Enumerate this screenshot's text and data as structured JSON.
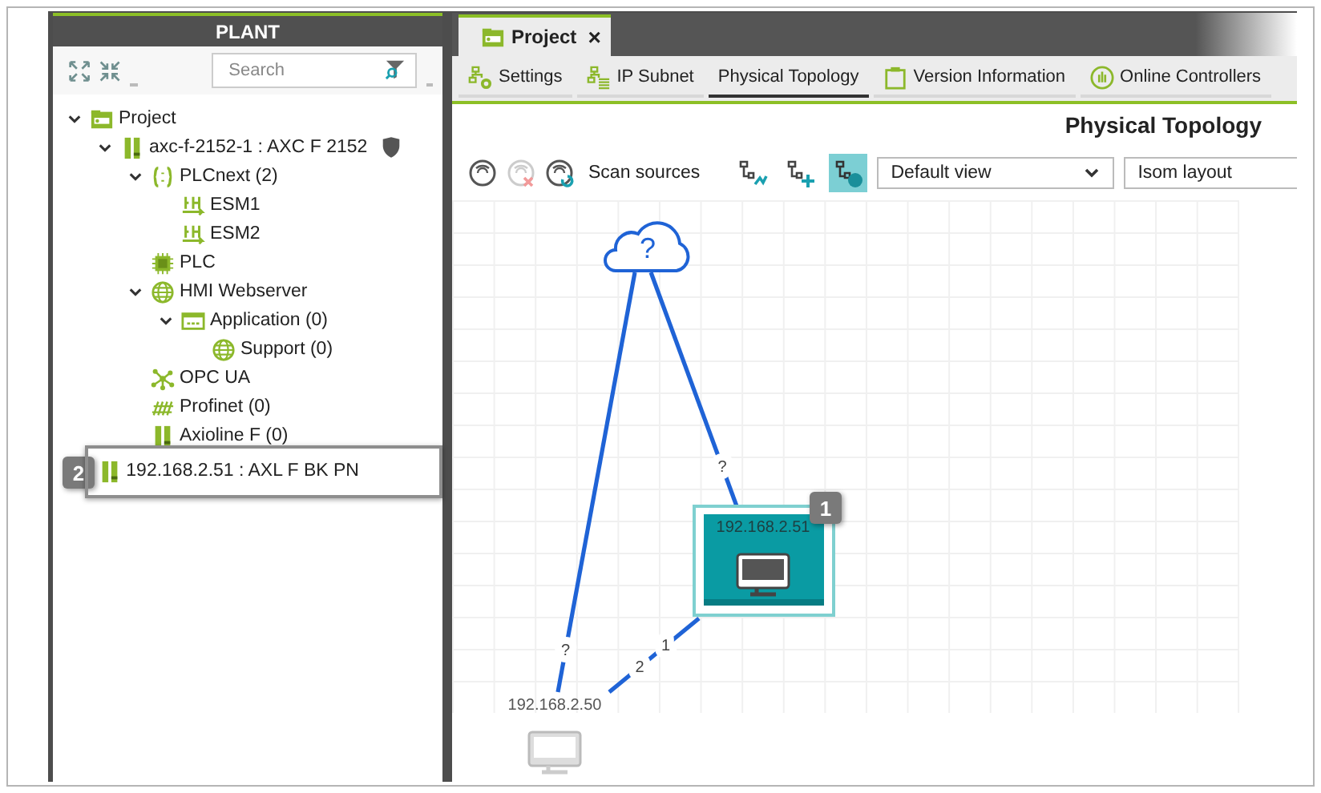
{
  "plant": {
    "title": "PLANT",
    "search": {
      "placeholder": "Search"
    },
    "tree": [
      {
        "label": "Project",
        "kind": "project",
        "expanded": true,
        "children": [
          {
            "label": "axc-f-2152-1 : AXC F 2152",
            "kind": "controller",
            "secured": true,
            "expanded": true,
            "children": [
              {
                "label": "PLCnext (2)",
                "kind": "plcnext",
                "expanded": true,
                "children": [
                  {
                    "label": "ESM1",
                    "kind": "esm"
                  },
                  {
                    "label": "ESM2",
                    "kind": "esm"
                  }
                ]
              },
              {
                "label": "PLC",
                "kind": "plc"
              },
              {
                "label": "HMI Webserver",
                "kind": "web",
                "expanded": true,
                "children": [
                  {
                    "label": "Application (0)",
                    "kind": "app",
                    "expanded": true,
                    "children": [
                      {
                        "label": "Support (0)",
                        "kind": "web"
                      }
                    ]
                  }
                ]
              },
              {
                "label": "OPC UA",
                "kind": "opcua"
              },
              {
                "label": "Profinet (0)",
                "kind": "profinet"
              },
              {
                "label": "Axioline F (0)",
                "kind": "axioline"
              }
            ]
          },
          {
            "label": "192.168.2.51 : AXL F BK PN",
            "kind": "controller",
            "highlighted": true,
            "callout": "2"
          }
        ]
      }
    ]
  },
  "editor": {
    "tabs": [
      {
        "label": "Project",
        "close": "×",
        "selected": true
      }
    ],
    "views": [
      {
        "label": "Settings",
        "kind": "settings",
        "selected": false
      },
      {
        "label": "IP Subnet",
        "kind": "subnet",
        "selected": false
      },
      {
        "label": "Physical Topology",
        "kind": "plain",
        "selected": true
      },
      {
        "label": "Version Information",
        "kind": "version",
        "selected": false
      },
      {
        "label": "Online Controllers",
        "kind": "online",
        "selected": false
      }
    ],
    "heading": "Physical Topology",
    "scan_tools": [
      {
        "kind": "scan",
        "disabled": false
      },
      {
        "kind": "stop",
        "disabled": true
      },
      {
        "kind": "rescan",
        "disabled": false
      }
    ],
    "scan_label": "Scan sources",
    "layout_tools": [
      {
        "kind": "arrange",
        "selected": false
      },
      {
        "kind": "add",
        "selected": false
      },
      {
        "kind": "auto",
        "selected": true
      }
    ],
    "view_select": {
      "value": "Default view"
    },
    "layout_select": {
      "value": "Isom layout"
    },
    "topology": {
      "nodes": [
        {
          "kind": "cloud",
          "label": "?"
        },
        {
          "kind": "device",
          "label": "192.168.2.51",
          "selected": true,
          "callout": "1"
        },
        {
          "kind": "device",
          "label": "192.168.2.50",
          "selected": false
        }
      ],
      "edges": [
        {
          "labels": [
            "?"
          ]
        },
        {
          "labels": [
            "?"
          ]
        },
        {
          "labels": [
            "1",
            "2"
          ]
        }
      ]
    }
  }
}
